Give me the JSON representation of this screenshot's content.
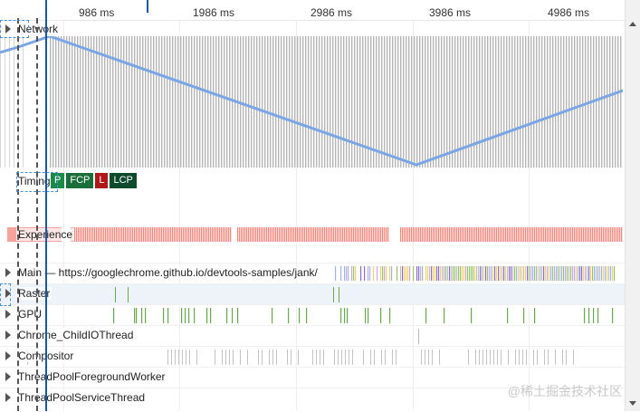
{
  "ruler": {
    "ticks": [
      "986 ms",
      "1986 ms",
      "2986 ms",
      "3986 ms",
      "4986 ms"
    ]
  },
  "tracks": {
    "network": "Network",
    "timings": "Timings",
    "experience": "Experience",
    "main": "Main — https://googlechrome.github.io/devtools-samples/jank/",
    "raster": "Raster",
    "gpu": "GPU",
    "child_io": "Chrome_ChildIOThread",
    "compositor": "Compositor",
    "pool_fg": "ThreadPoolForegroundWorker",
    "pool_svc": "ThreadPoolServiceThread"
  },
  "timing_markers": [
    "P",
    "FCP",
    "L",
    "LCP"
  ],
  "watermark": "@稀土掘金技术社区",
  "colors": {
    "cursor": "#1a56a8",
    "network_line": "#7aa6e6",
    "experience": "#f28b82",
    "gpu": "#6aa84f",
    "raster": "#6aa84f"
  }
}
